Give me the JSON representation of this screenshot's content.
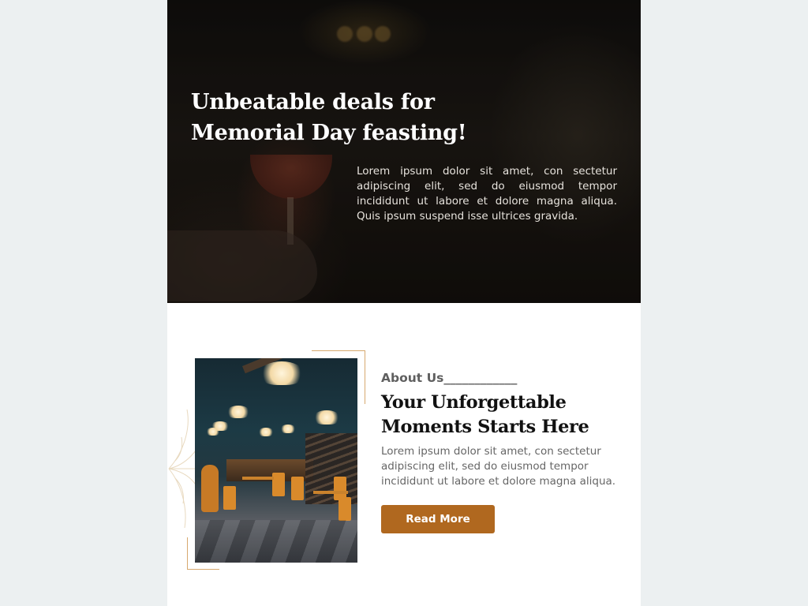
{
  "colors": {
    "page_background": "#ecf0f1",
    "card_background": "#ffffff",
    "hero_overlay": "#1a1612",
    "accent": "#b0681f",
    "frame_accent": "#d7a96f",
    "heading_text": "#111111",
    "body_text": "#666666"
  },
  "hero": {
    "title": "Unbeatable deals for Memorial Day feasting!",
    "text": "Lorem ipsum dolor sit amet, con sectetur adipiscing elit, sed do eiusmod tempor incididunt ut labore et dolore magna aliqua. Quis ipsum suspend isse ultrices gravida."
  },
  "about": {
    "label": "About Us____________",
    "title": "Your Unforgettable Moments Starts Here",
    "text": "Lorem ipsum dolor sit amet, con sectetur adipiscing elit, sed do eiusmod tempor incididunt ut labore et dolore magna aliqua.",
    "button_label": "Read More",
    "decoration_icon": "leaf-outline-icon"
  }
}
